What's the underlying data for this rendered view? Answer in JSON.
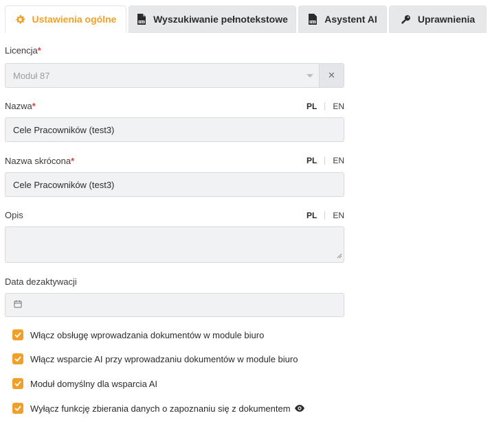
{
  "tabs": [
    {
      "label": "Ustawienia ogólne",
      "icon": "gear-icon",
      "active": true
    },
    {
      "label": "Wyszukiwanie pełnotekstowe",
      "icon": "pdf-file-icon",
      "active": false
    },
    {
      "label": "Asystent AI",
      "icon": "pdf-file-icon",
      "active": false
    },
    {
      "label": "Uprawnienia",
      "icon": "key-icon",
      "active": false
    }
  ],
  "form": {
    "license": {
      "label": "Licencja",
      "required": "*",
      "value": "Moduł 87",
      "clear_symbol": "✕"
    },
    "name": {
      "label": "Nazwa",
      "required": "*",
      "value": "Cele Pracowników (test3)",
      "lang_pl": "PL",
      "lang_en": "EN"
    },
    "short_name": {
      "label": "Nazwa skrócona",
      "required": "*",
      "value": "Cele Pracowników (test3)",
      "lang_pl": "PL",
      "lang_en": "EN"
    },
    "description": {
      "label": "Opis",
      "value": "",
      "lang_pl": "PL",
      "lang_en": "EN"
    },
    "deactivation_date": {
      "label": "Data dezaktywacji",
      "value": ""
    }
  },
  "checkboxes": [
    {
      "label": "Włącz obsługę wprowadzania dokumentów w module biuro",
      "checked": true
    },
    {
      "label": "Włącz wsparcie AI przy wprowadzaniu dokumentów w module biuro",
      "checked": true
    },
    {
      "label": "Moduł domyślny dla wsparcia AI",
      "checked": true
    },
    {
      "label": "Wyłącz funkcję zbierania danych o zapoznaniu się z dokumentem",
      "checked": true
    }
  ],
  "colors": {
    "accent": "#f0a028",
    "required": "#e23c3c",
    "field_bg": "#f1f2f4",
    "tab_bg": "#e7e8ea"
  }
}
